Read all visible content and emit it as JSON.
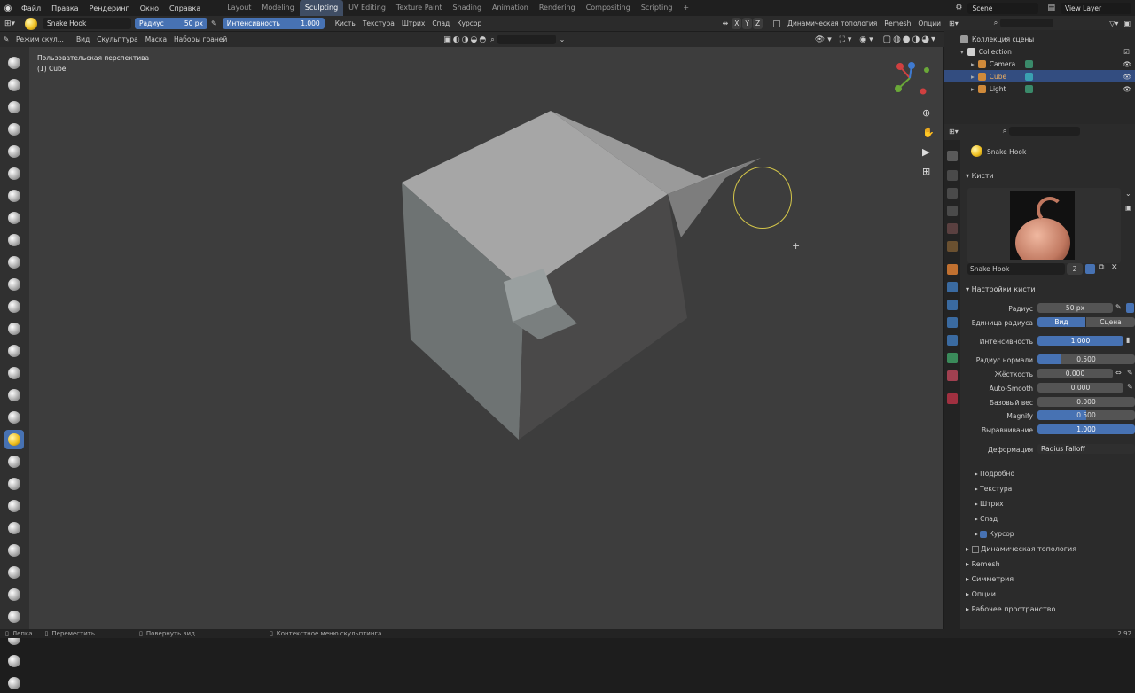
{
  "topbar": {
    "menus": [
      "Файл",
      "Правка",
      "Рендеринг",
      "Окно",
      "Справка"
    ],
    "workspaces": [
      "Layout",
      "Modeling",
      "Sculpting",
      "UV Editing",
      "Texture Paint",
      "Shading",
      "Animation",
      "Rendering",
      "Compositing",
      "Scripting"
    ],
    "active_workspace": "Sculpting",
    "add_tab": "+",
    "scene": "Scene",
    "view_layer": "View Layer"
  },
  "toolhdr": {
    "brush_name": "Snake Hook",
    "radius_label": "Радиус",
    "radius_value": "50 px",
    "strength_label": "Интенсивность",
    "strength_value": "1.000",
    "menus": [
      "Кисть",
      "Текстура",
      "Штрих",
      "Спад",
      "Курсор"
    ],
    "axes": [
      "X",
      "Y",
      "Z"
    ],
    "dyntopo": "Динамическая топология",
    "remesh": "Remesh",
    "options": "Опции"
  },
  "modehdr": {
    "mode": "Режим скул...",
    "menus": [
      "Вид",
      "Скульптура",
      "Маска",
      "Наборы граней"
    ]
  },
  "viewport": {
    "perspective": "Пользовательская перспектива",
    "object": "(1) Cube"
  },
  "gizmo": {
    "x": "X",
    "y": "Y",
    "z": "Z"
  },
  "outliner": {
    "scene_collection": "Коллекция сцены",
    "collection": "Collection",
    "items": [
      "Camera",
      "Cube",
      "Light"
    ],
    "selected": "Cube"
  },
  "props": {
    "brush_title": "Snake Hook",
    "brushes_header": "Кисти",
    "brush_field": "Snake Hook",
    "brush_users": "2",
    "settings_header": "Настройки кисти",
    "radius_label": "Радиус",
    "radius_value": "50 px",
    "radius_unit_label": "Единица радиуса",
    "unit_view": "Вид",
    "unit_scene": "Сцена",
    "strength_label": "Интенсивность",
    "strength_value": "1.000",
    "normal_radius_label": "Радиус нормали",
    "normal_radius_value": "0.500",
    "hardness_label": "Жёсткость",
    "hardness_value": "0.000",
    "autosmooth_label": "Auto-Smooth",
    "autosmooth_value": "0.000",
    "weight_label": "Базовый вес",
    "weight_value": "0.000",
    "magnify_label": "Magnify",
    "magnify_value": "0.500",
    "align_label": "Выравнивание",
    "align_value": "1.000",
    "deform_label": "Деформация",
    "deform_value": "Radius Falloff",
    "subpanels": [
      "Подробно",
      "Текстура",
      "Штрих",
      "Спад",
      "Курсор"
    ],
    "panels": [
      "Динамическая топология",
      "Remesh",
      "Симметрия",
      "Опции",
      "Рабочее пространство"
    ]
  },
  "status": {
    "items": [
      "Лепка",
      "Переместить",
      "Повернуть вид",
      "Контекстное меню скульптинга"
    ],
    "version": "2.92"
  }
}
